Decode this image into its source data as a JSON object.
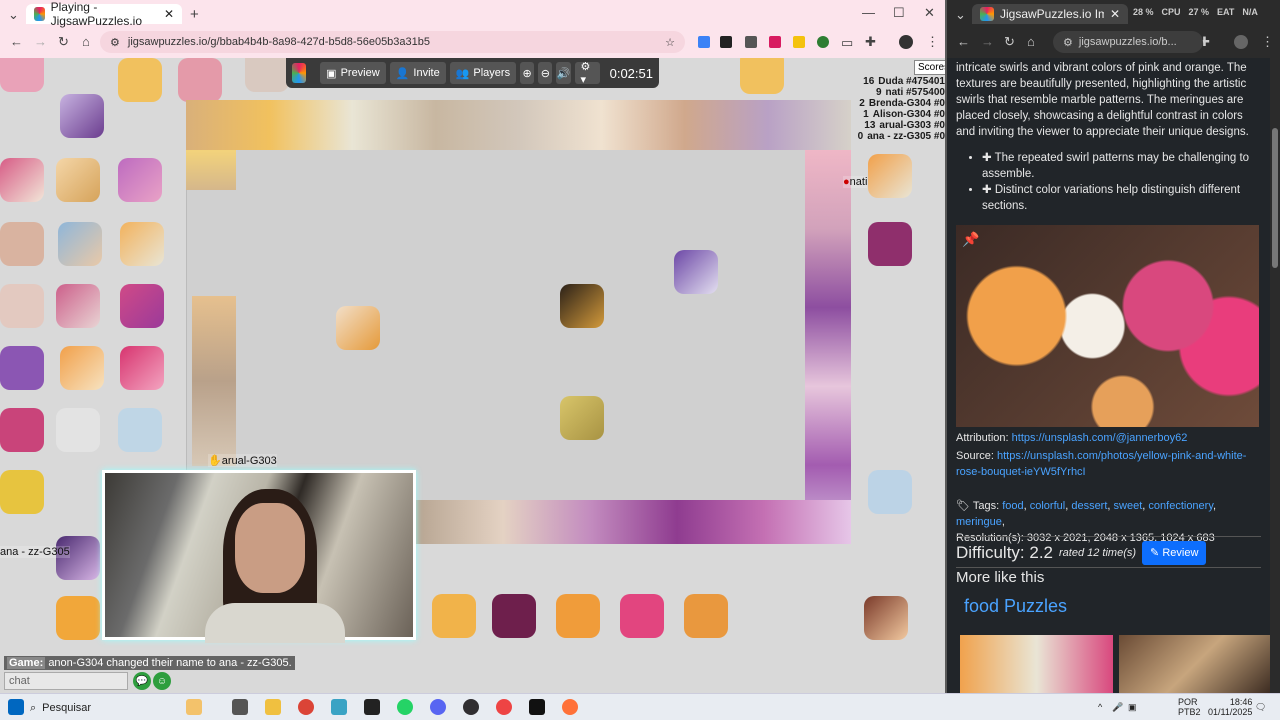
{
  "browser_left": {
    "tab_title": "Playing - JigsawPuzzles.io",
    "url": "jigsawpuzzles.io/g/bbab4b4b-8a98-427d-b5d8-56e05b3a31b5",
    "new_tab": "+"
  },
  "browser_right": {
    "tab_title": "JigsawPuzzles.io Image - Vibrant",
    "url": "jigsawpuzzles.io/b...",
    "stats": {
      "ram": "28 %",
      "cpu_label": "CPU",
      "cpu": "27 %",
      "eat": "EAT",
      "eat_val": "N/A"
    }
  },
  "toolbar": {
    "preview": "Preview",
    "invite": "Invite",
    "players": "Players",
    "timer": "0:02:51"
  },
  "scores_tooltip": "Scores",
  "scores": [
    {
      "count": "16",
      "name": "Duda #475401"
    },
    {
      "count": "9",
      "name": "nati #575400"
    },
    {
      "count": "2",
      "name": "Brenda-G304 #0"
    },
    {
      "count": "1",
      "name": "Alison-G304 #0"
    },
    {
      "count": "13",
      "name": "arual-G303 #0"
    },
    {
      "count": "0",
      "name": "ana - zz-G305 #0"
    }
  ],
  "cursors": {
    "nati": "nati",
    "arual": "arual-G303",
    "ana": "ana - zz-G305"
  },
  "chat": {
    "label": "Game:",
    "message": "anon-G304 changed their name to ana - zz-G305.",
    "placeholder": "chat"
  },
  "panel": {
    "description": "intricate swirls and vibrant colors of pink and orange. The textures are beautifully presented, highlighting the artistic swirls that resemble marble patterns. The meringues are placed closely, showcasing a delightful contrast in colors and inviting the viewer to appreciate their unique designs.",
    "bullets": [
      "The repeated swirl patterns may be challenging to assemble.",
      "Distinct color variations help distinguish different sections."
    ],
    "attribution_label": "Attribution:",
    "attribution_link": "https://unsplash.com/@jannerboy62",
    "source_label": "Source:",
    "source_link": "https://unsplash.com/photos/yellow-pink-and-white-rose-bouquet-ieYW5fYrhcI",
    "tags_label": "Tags:",
    "tags": [
      "food",
      "colorful",
      "dessert",
      "sweet",
      "confectionery",
      "meringue"
    ],
    "resolution": "Resolution(s): 3032 x 2021, 2048 x 1365, 1024 x 683",
    "difficulty": "Difficulty: 2.2",
    "rated": "rated 12 time(s)",
    "review": "Review",
    "more_like": "More like this",
    "food_puzzles": "food Puzzles"
  },
  "taskbar": {
    "search": "Pesquisar",
    "lang": "POR",
    "layout": "PTB2",
    "time": "18:46",
    "date": "01/11/2025"
  },
  "colors": {
    "accent": "#0d6efd",
    "link": "#4aa3ff",
    "chrome_pink": "#fce4ec",
    "panel_bg": "#212529"
  }
}
